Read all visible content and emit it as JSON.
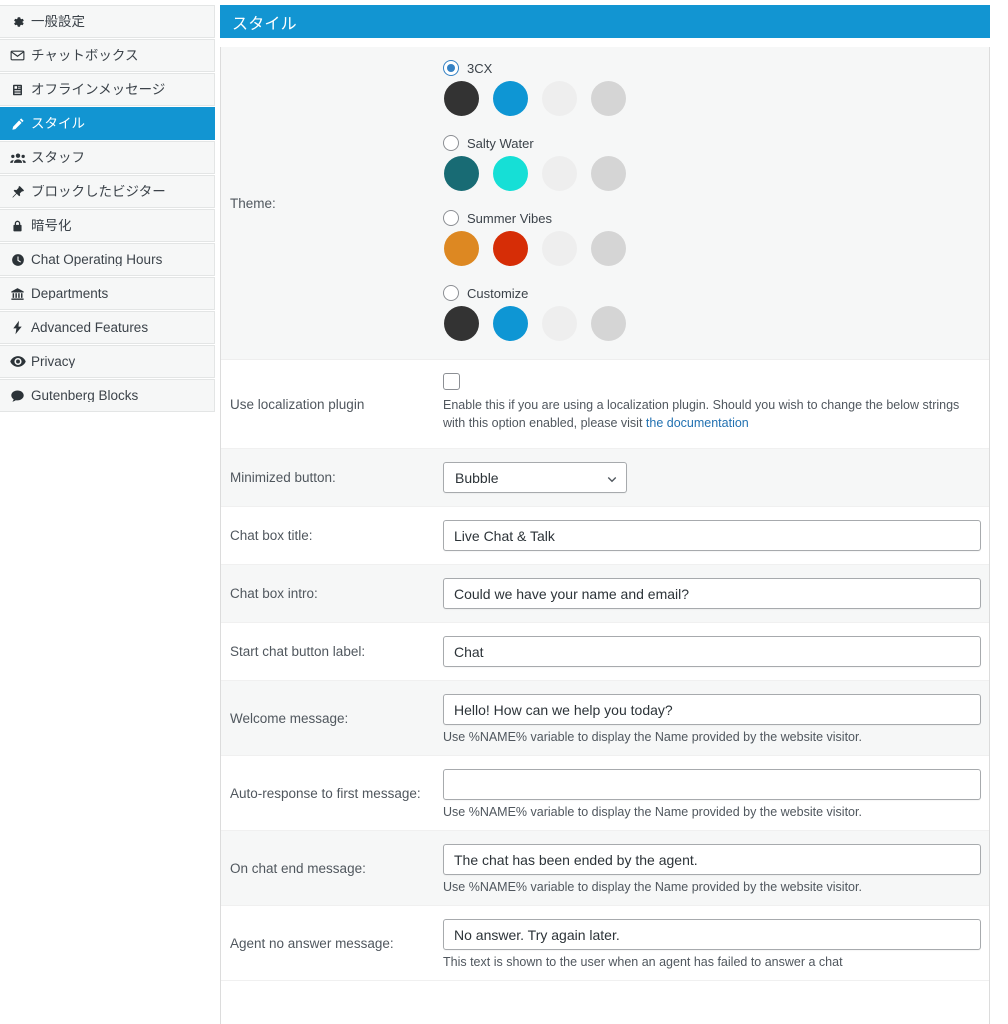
{
  "sidebar": {
    "items": [
      {
        "label": "一般設定",
        "icon": "gear-icon",
        "name": "general-settings",
        "active": false
      },
      {
        "label": "チャットボックス",
        "icon": "envelope-icon",
        "name": "chat-box",
        "active": false
      },
      {
        "label": "オフラインメッセージ",
        "icon": "list-icon",
        "name": "offline-message",
        "active": false
      },
      {
        "label": "スタイル",
        "icon": "pencil-icon",
        "name": "style",
        "active": true
      },
      {
        "label": "スタッフ",
        "icon": "users-icon",
        "name": "staff",
        "active": false
      },
      {
        "label": "ブロックしたビジター",
        "icon": "pin-icon",
        "name": "blocked-visitors",
        "active": false
      },
      {
        "label": "暗号化",
        "icon": "lock-icon",
        "name": "encryption",
        "active": false
      },
      {
        "label": "Chat Operating Hours",
        "icon": "clock-icon",
        "name": "chat-operating-hours",
        "active": false
      },
      {
        "label": "Departments",
        "icon": "bank-icon",
        "name": "departments",
        "active": false
      },
      {
        "label": "Advanced Features",
        "icon": "bolt-icon",
        "name": "advanced-features",
        "active": false
      },
      {
        "label": "Privacy",
        "icon": "eye-icon",
        "name": "privacy",
        "active": false
      },
      {
        "label": "Gutenberg Blocks",
        "icon": "comment-icon",
        "name": "gutenberg-blocks",
        "active": false
      }
    ]
  },
  "panel": {
    "title": "スタイル",
    "header_color": "#1295d2"
  },
  "theme": {
    "label": "Theme:",
    "options": [
      {
        "label": "3CX",
        "selected": true,
        "swatches": [
          "#333333",
          "#0e96d4",
          "#eeeeee",
          "#d5d5d5"
        ]
      },
      {
        "label": "Salty Water",
        "selected": false,
        "swatches": [
          "#186b74",
          "#16dfd6",
          "#eeeeee",
          "#d5d5d5"
        ]
      },
      {
        "label": "Summer Vibes",
        "selected": false,
        "swatches": [
          "#dd8822",
          "#d62d06",
          "#eeeeee",
          "#d5d5d5"
        ]
      },
      {
        "label": "Customize",
        "selected": false,
        "swatches": [
          "#333333",
          "#0e96d4",
          "#eeeeee",
          "#d5d5d5"
        ]
      }
    ]
  },
  "localization": {
    "label": "Use localization plugin",
    "checked": false,
    "help_part1": "Enable this if you are using a localization plugin. Should you wish to change the below strings with this option enabled, please visit ",
    "help_link": "the documentation"
  },
  "minimized_button": {
    "label": "Minimized button:",
    "value": "Bubble"
  },
  "fields": [
    {
      "name": "chat-box-title",
      "label": "Chat box title:",
      "value": "Live Chat & Talk",
      "placeholder": "",
      "note": ""
    },
    {
      "name": "chat-box-intro",
      "label": "Chat box intro:",
      "value": "Could we have your name and email?",
      "placeholder": "",
      "note": ""
    },
    {
      "name": "start-chat-button-label",
      "label": "Start chat button label:",
      "value": "Chat",
      "placeholder": "",
      "note": ""
    },
    {
      "name": "welcome-message",
      "label": "Welcome message:",
      "value": "Hello! How can we help you today?",
      "placeholder": "",
      "note": "Use %NAME% variable to display the Name provided by the website visitor."
    },
    {
      "name": "auto-response-first-message",
      "label": "Auto-response to first message:",
      "value": "",
      "placeholder": "",
      "note": "Use %NAME% variable to display the Name provided by the website visitor."
    },
    {
      "name": "on-chat-end-message",
      "label": "On chat end message:",
      "value": "The chat has been ended by the agent.",
      "placeholder": "",
      "note": "Use %NAME% variable to display the Name provided by the website visitor."
    },
    {
      "name": "agent-no-answer-message",
      "label": "Agent no answer message:",
      "value": "No answer. Try again later.",
      "placeholder": "",
      "note": "This text is shown to the user when an agent has failed to answer a chat"
    }
  ]
}
